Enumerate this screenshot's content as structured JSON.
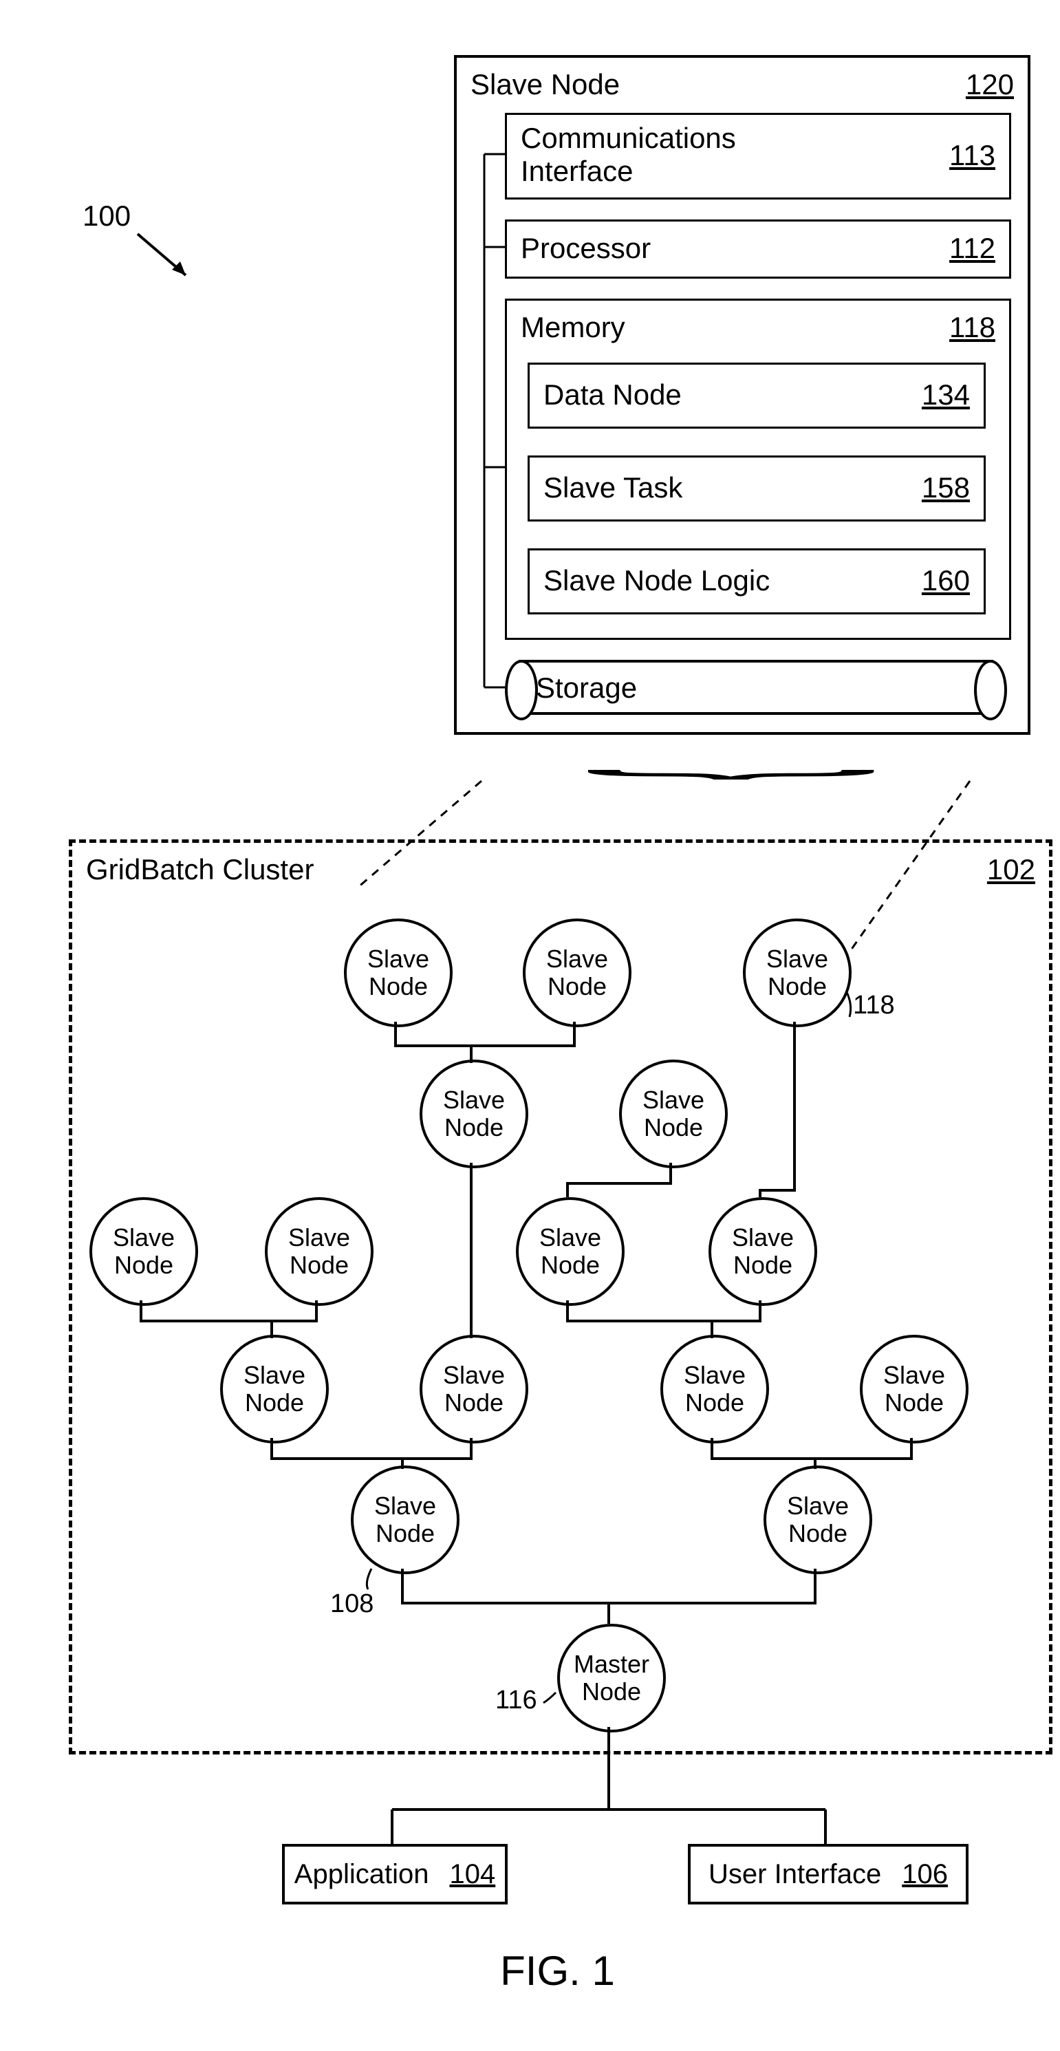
{
  "figure_ref": "100",
  "figure_caption": "FIG. 1",
  "slave_detail": {
    "title": "Slave Node",
    "num": "120",
    "comm": {
      "label": "Communications Interface",
      "num": "113"
    },
    "processor": {
      "label": "Processor",
      "num": "112"
    },
    "memory": {
      "label": "Memory",
      "num": "118",
      "data_node": {
        "label": "Data Node",
        "num": "134"
      },
      "slave_task": {
        "label": "Slave Task",
        "num": "158"
      },
      "slave_logic": {
        "label": "Slave Node Logic",
        "num": "160"
      }
    },
    "storage_label": "Storage"
  },
  "cluster": {
    "title": "GridBatch Cluster",
    "num": "102",
    "slave_label": "Slave Node",
    "master_label": "Master Node",
    "ref_118": "118",
    "ref_108": "108",
    "ref_116": "116"
  },
  "bottom": {
    "application": {
      "label": "Application",
      "num": "104"
    },
    "ui": {
      "label": "User Interface",
      "num": "106"
    }
  }
}
